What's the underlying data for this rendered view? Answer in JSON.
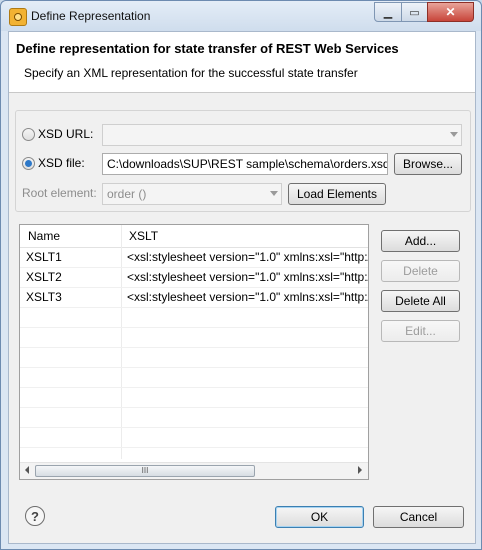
{
  "window": {
    "title": "Define Representation",
    "controls": {
      "minimize": "▁",
      "maximize": "▭",
      "close": "✕"
    }
  },
  "header": {
    "title": "Define representation for state transfer of REST Web Services",
    "subtitle": "Specify an XML representation for the successful state transfer"
  },
  "source": {
    "xsd_url_label": "XSD URL:",
    "xsd_url_value": "",
    "xsd_file_label": "XSD file:",
    "xsd_file_value": "C:\\downloads\\SUP\\REST sample\\schema\\orders.xsd",
    "browse_label": "Browse...",
    "root_element_label": "Root element:",
    "root_element_value": "order ()",
    "load_elements_label": "Load Elements",
    "selected": "xsd_file"
  },
  "table": {
    "columns": [
      "Name",
      "XSLT"
    ],
    "rows": [
      {
        "name": "XSLT1",
        "xslt": "<xsl:stylesheet version=\"1.0\" xmlns:xsl=\"http://"
      },
      {
        "name": "XSLT2",
        "xslt": "<xsl:stylesheet version=\"1.0\" xmlns:xsl=\"http://"
      },
      {
        "name": "XSLT3",
        "xslt": "<xsl:stylesheet version=\"1.0\" xmlns:xsl=\"http://"
      }
    ],
    "scroll_thumb_grip": "III"
  },
  "side_buttons": {
    "add": "Add...",
    "delete": "Delete",
    "delete_all": "Delete All",
    "edit": "Edit..."
  },
  "footer": {
    "help_glyph": "?",
    "ok": "OK",
    "cancel": "Cancel"
  },
  "colors": {
    "accent": "#2d78c8",
    "titlebar": "#cfdded",
    "dialog_bg": "#f0f0f0"
  }
}
